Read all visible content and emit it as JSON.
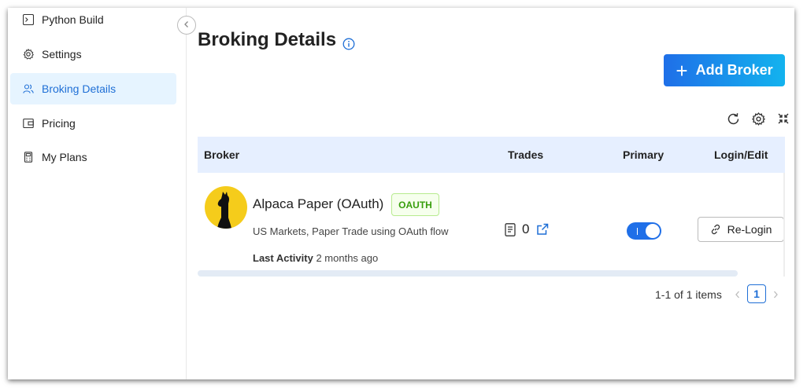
{
  "sidebar": {
    "items": [
      {
        "label": "Python Build",
        "icon": "terminal-icon"
      },
      {
        "label": "Settings",
        "icon": "gear-icon"
      },
      {
        "label": "Broking Details",
        "icon": "users-icon",
        "active": true
      },
      {
        "label": "Pricing",
        "icon": "wallet-icon"
      },
      {
        "label": "My Plans",
        "icon": "calculator-icon"
      }
    ]
  },
  "page": {
    "title": "Broking Details",
    "add_button": "Add Broker"
  },
  "table": {
    "columns": [
      "Broker",
      "Trades",
      "Primary",
      "Login/Edit"
    ],
    "rows": [
      {
        "broker_name": "Alpaca Paper (OAuth)",
        "tag": "OAUTH",
        "description": "US Markets, Paper Trade using OAuth flow",
        "last_activity_label": "Last Activity",
        "last_activity_value": "2 months ago",
        "trades": "0",
        "primary": true,
        "action_label": "Re-Login"
      }
    ]
  },
  "pagination": {
    "summary": "1-1 of 1 items",
    "current_page": "1"
  },
  "colors": {
    "accent": "#1f6fd6",
    "tag_green": "#389e0d",
    "header_bg": "#e6efff",
    "active_bg": "#e6f4ff"
  }
}
